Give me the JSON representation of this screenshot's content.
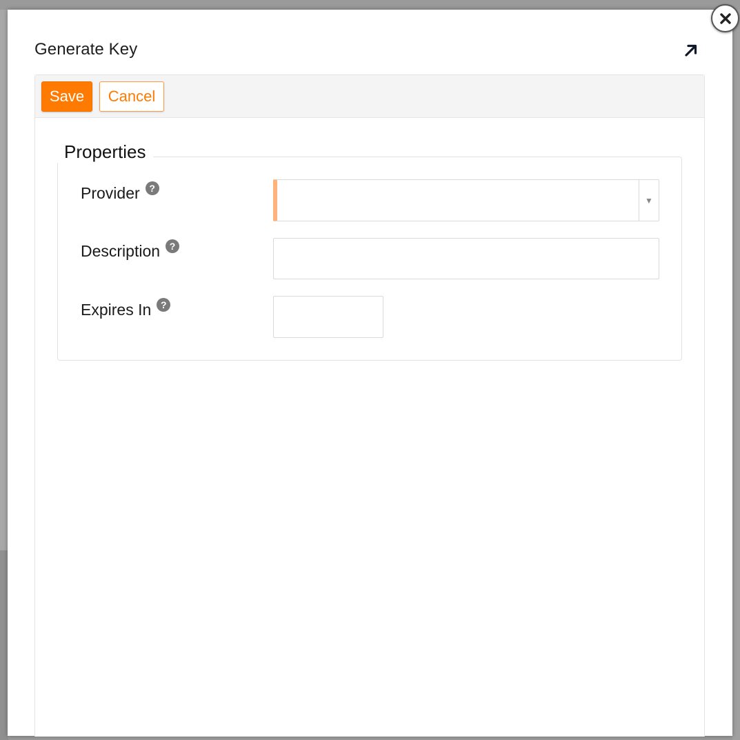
{
  "dialog": {
    "title": "Generate Key",
    "toolbar": {
      "save_label": "Save",
      "cancel_label": "Cancel"
    },
    "properties": {
      "legend": "Properties",
      "fields": {
        "provider": {
          "label": "Provider",
          "value": ""
        },
        "description": {
          "label": "Description",
          "value": ""
        },
        "expires_in": {
          "label": "Expires In",
          "value": ""
        }
      }
    }
  },
  "icons": {
    "close": "close-icon",
    "maximize": "maximize-arrow-icon",
    "help": "question-mark-icon",
    "dropdown": "caret-down-icon"
  },
  "colors": {
    "accent": "#ff7a00",
    "required_marker": "#ffb27a",
    "help_icon": "#7a7a7a"
  }
}
